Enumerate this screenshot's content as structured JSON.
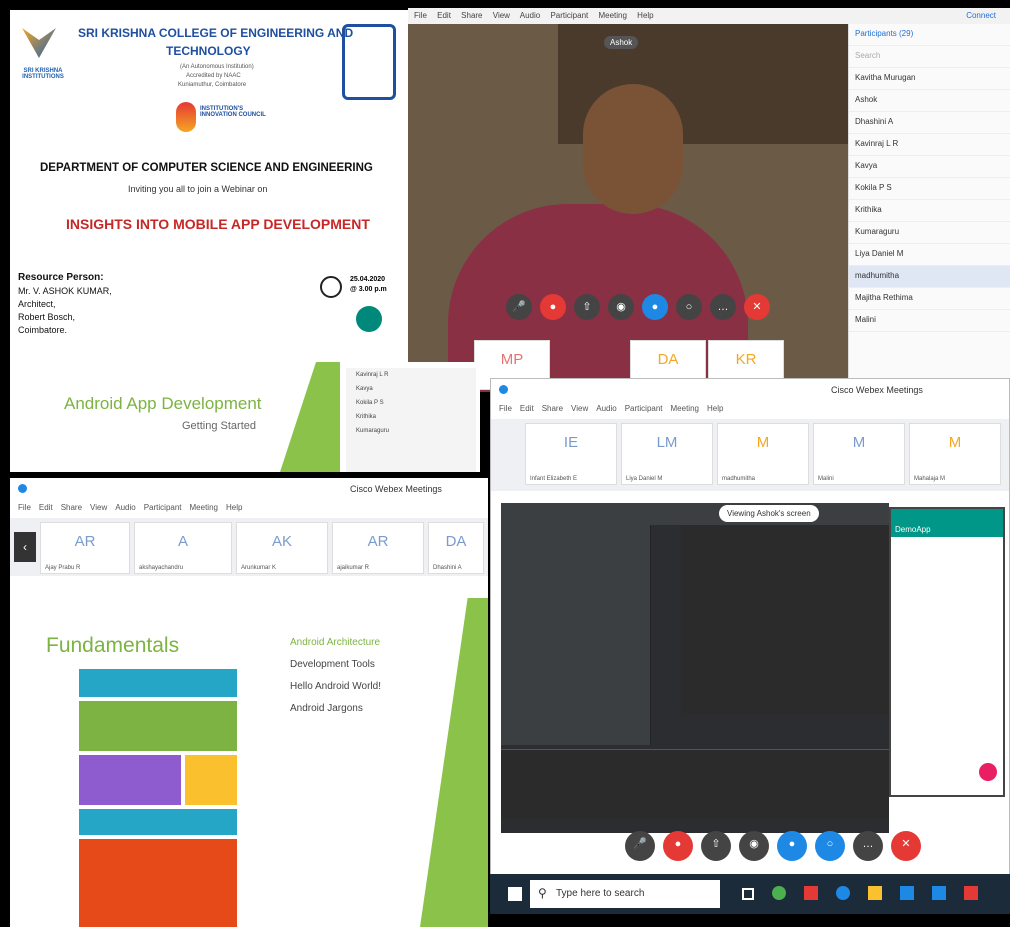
{
  "poster": {
    "college": "SRI KRISHNA COLLEGE OF ENGINEERING AND",
    "college2": "TECHNOLOGY",
    "sub1": "(An Autonomous Institution)",
    "sub2": "Accredited by NAAC",
    "sub3": "Kuniamuthur, Coimbatore",
    "logo_text": "SRI KRISHNA INSTITUTIONS",
    "council": "INSTITUTION'S INNOVATION COUNCIL",
    "dept": "DEPARTMENT OF COMPUTER SCIENCE AND ENGINEERING",
    "invite": "Inviting you all to join a Webinar on",
    "topic": "INSIGHTS INTO MOBILE APP DEVELOPMENT",
    "rp_label": "Resource Person:",
    "rp_name": "Mr. V. ASHOK KUMAR,",
    "rp_role": "Architect,",
    "rp_org": "Robert Bosch,",
    "rp_city": "Coimbatore.",
    "date": "25.04.2020",
    "time": "@ 3.00 p.m"
  },
  "call1": {
    "menu": [
      "File",
      "Edit",
      "Share",
      "View",
      "Audio",
      "Participant",
      "Meeting",
      "Help"
    ],
    "speaker": "Ashok",
    "connect": "Connect",
    "participants_header": "Participants (29)",
    "search": "Search",
    "participants": [
      "Kavitha Murugan",
      "Ashok",
      "Dhashini A",
      "Kavinraj L R",
      "Kavya",
      "Kokila P S",
      "Krithika",
      "Kumaraguru",
      "Liya Daniel M",
      "madhumitha",
      "Majitha Rethima",
      "Malini"
    ],
    "thumbs": [
      "MP",
      "DA",
      "KR"
    ]
  },
  "slide1": {
    "title": "Android App Development",
    "subtitle": "Getting Started",
    "side_names": [
      "Kavinraj L R",
      "Kavya",
      "Kokila P S",
      "Krithika",
      "Kumaraguru"
    ]
  },
  "win2": {
    "title": "Cisco Webex Meetings",
    "menu": [
      "File",
      "Edit",
      "Share",
      "View",
      "Audio",
      "Participant",
      "Meeting",
      "Help"
    ],
    "tiles": [
      {
        "ini": "AR",
        "name": "Ajay Prabu R"
      },
      {
        "ini": "A",
        "name": "akshayachandru"
      },
      {
        "ini": "AK",
        "name": "Arunkumar K"
      },
      {
        "ini": "AR",
        "name": "ajaikumar R"
      },
      {
        "ini": "DA",
        "name": "Dhashini A"
      }
    ],
    "slide_title": "Fundamentals",
    "bullets": [
      "Android Architecture",
      "Development Tools",
      "Hello Android World!",
      "Android Jargons"
    ]
  },
  "win3": {
    "title": "Cisco Webex Meetings",
    "menu": [
      "File",
      "Edit",
      "Share",
      "View",
      "Audio",
      "Participant",
      "Meeting",
      "Help"
    ],
    "tiles": [
      {
        "ini": "IE",
        "name": "Infant Elizabeth E"
      },
      {
        "ini": "LM",
        "name": "Liya Daniel M"
      },
      {
        "ini": "M",
        "name": "madhumitha"
      },
      {
        "ini": "M",
        "name": "Malini"
      },
      {
        "ini": "M",
        "name": "Mahalaja M"
      }
    ],
    "viewing": "Viewing Ashok's screen",
    "phone_app": "DemoApp",
    "search_placeholder": "Type here to search"
  },
  "colors": {
    "red": "#e53935",
    "blue": "#1e88e5",
    "green": "#8bc34a"
  }
}
